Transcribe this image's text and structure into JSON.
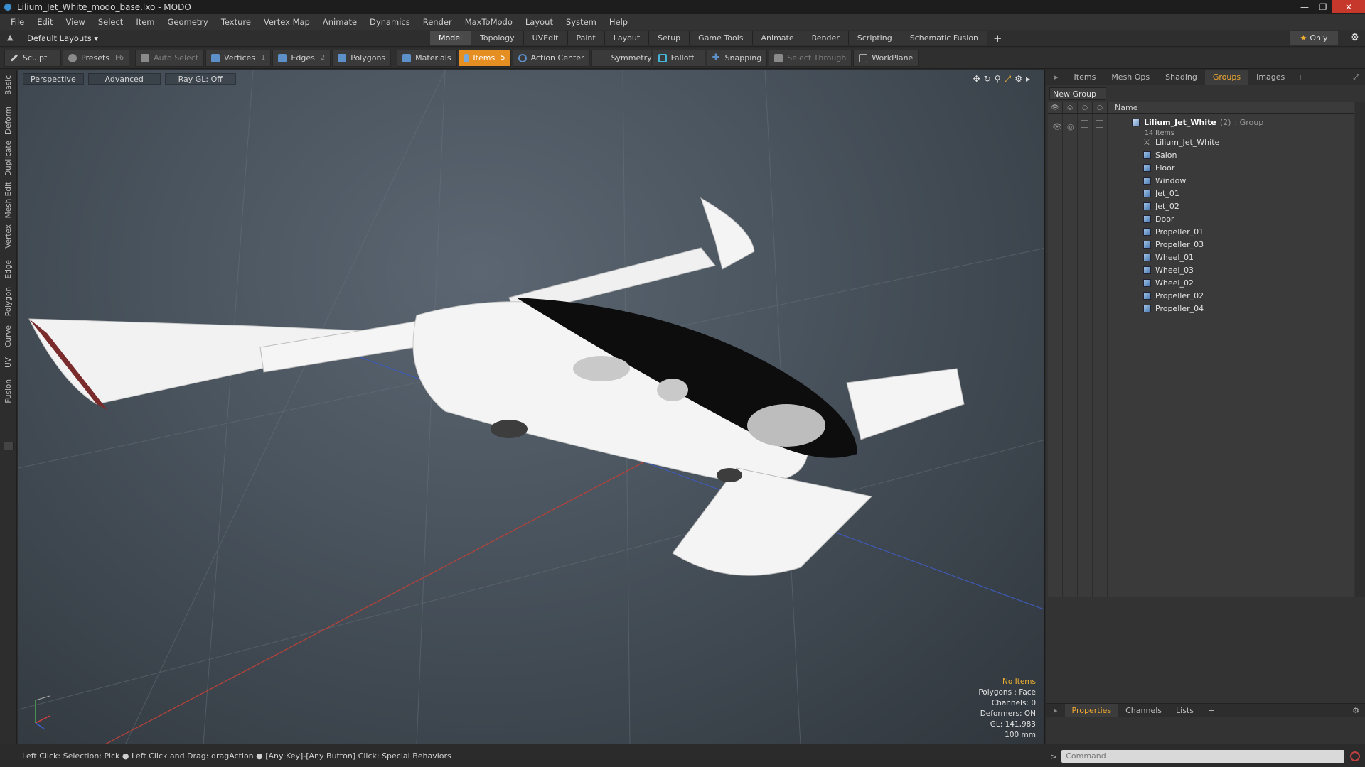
{
  "window": {
    "title": "Lilium_Jet_White_modo_base.lxo - MODO"
  },
  "menu": [
    "File",
    "Edit",
    "View",
    "Select",
    "Item",
    "Geometry",
    "Texture",
    "Vertex Map",
    "Animate",
    "Dynamics",
    "Render",
    "MaxToModo",
    "Layout",
    "System",
    "Help"
  ],
  "layout": {
    "dropdown": "Default Layouts ▾",
    "tabs": [
      "Model",
      "Topology",
      "UVEdit",
      "Paint",
      "Layout",
      "Setup",
      "Game Tools",
      "Animate",
      "Render",
      "Scripting",
      "Schematic Fusion"
    ],
    "active_tab": "Model",
    "add": "+",
    "only": "Only"
  },
  "toolbar": {
    "sculpt": "Sculpt",
    "presets": "Presets",
    "presets_key": "F6",
    "auto_select": "Auto Select",
    "vertices": "Vertices",
    "vertices_key": "1",
    "edges": "Edges",
    "edges_key": "2",
    "polygons": "Polygons",
    "materials": "Materials",
    "items": "Items",
    "items_key": "5",
    "action_center": "Action Center",
    "symmetry": "Symmetry",
    "falloff": "Falloff",
    "snapping": "Snapping",
    "select_through": "Select Through",
    "workplane": "WorkPlane"
  },
  "left_tabs": [
    "Basic",
    "Deform",
    "Duplicate",
    "Mesh Edit",
    "Vertex",
    "Edge",
    "Polygon",
    "Curve",
    "UV",
    "Fusion"
  ],
  "viewport": {
    "view": "Perspective",
    "shading": "Advanced",
    "raygl": "Ray GL: Off",
    "info": {
      "no_items": "No Items",
      "polygons": "Polygons : Face",
      "channels": "Channels: 0",
      "deformers": "Deformers: ON",
      "gl": "GL: 141,983",
      "scale": "100 mm"
    }
  },
  "panel": {
    "tabs": [
      "Items",
      "Mesh Ops",
      "Shading",
      "Groups",
      "Images"
    ],
    "active_tab": "Groups",
    "new_group": "New Group",
    "name_header": "Name",
    "group": {
      "name": "Lilium_Jet_White",
      "count": "(2)",
      "type": ": Group",
      "items_count": "14 Items"
    },
    "items": [
      {
        "name": "Lilium_Jet_White",
        "kind": "locator"
      },
      {
        "name": "Salon",
        "kind": "mesh"
      },
      {
        "name": "Floor",
        "kind": "mesh"
      },
      {
        "name": "Window",
        "kind": "mesh"
      },
      {
        "name": "Jet_01",
        "kind": "mesh"
      },
      {
        "name": "Jet_02",
        "kind": "mesh"
      },
      {
        "name": "Door",
        "kind": "mesh"
      },
      {
        "name": "Propeller_01",
        "kind": "mesh"
      },
      {
        "name": "Propeller_03",
        "kind": "mesh"
      },
      {
        "name": "Wheel_01",
        "kind": "mesh"
      },
      {
        "name": "Wheel_03",
        "kind": "mesh"
      },
      {
        "name": "Wheel_02",
        "kind": "mesh"
      },
      {
        "name": "Propeller_02",
        "kind": "mesh"
      },
      {
        "name": "Propeller_04",
        "kind": "mesh"
      }
    ],
    "bottom_tabs": [
      "Properties",
      "Channels",
      "Lists"
    ],
    "bottom_active": "Properties"
  },
  "status": {
    "hint": "Left Click: Selection: Pick ● Left Click and Drag: dragAction ● [Any Key]-[Any Button] Click: Special Behaviors"
  },
  "command": {
    "placeholder": "Command"
  },
  "colors": {
    "accent": "#f0a830",
    "active_tool": "#e58e22",
    "close": "#c7382c"
  }
}
